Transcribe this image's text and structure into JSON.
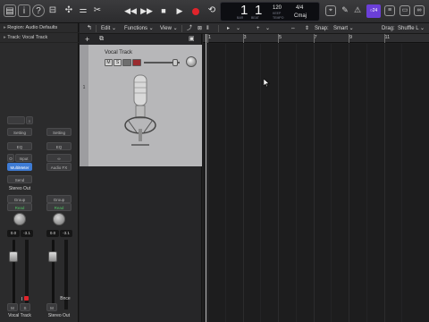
{
  "control_bar": {
    "lcd": {
      "bar": "1",
      "beat": "1",
      "bar_caption": "BAR",
      "beat_caption": "BEAT",
      "tempo": "120",
      "tempo_caption": "KEEP",
      "tempo_caption_2": "TEMPO",
      "signature": "4/4",
      "key": "Cmaj"
    },
    "cpu_label": "○24"
  },
  "inspector": {
    "region_label": "Region: Audio Defaults",
    "track_label": "Track: Vocal Track",
    "channel1": {
      "setting": "Setting",
      "eq": "EQ",
      "input": "Input",
      "input_icon": "O",
      "audio_fx": "MultiMeter",
      "send": "Send",
      "output": "Stereo Out",
      "group": "Group",
      "automation": "Read",
      "pan_value": "0.0",
      "level_value": "-3.1",
      "mute": "M",
      "solo": "S",
      "record": "I",
      "name": "Vocal Track"
    },
    "channel2": {
      "setting": "Setting",
      "eq": "EQ",
      "input_icon": "∞",
      "audio_fx": "Audio FX",
      "group": "Group",
      "automation": "Read",
      "pan_value": "0.0",
      "level_value": "-3.1",
      "bounce": "Bnce",
      "mute": "M",
      "solo": "S",
      "name": "Stereo Out"
    }
  },
  "tracks_header": {
    "edit": "Edit",
    "functions": "Functions",
    "view": "View",
    "snap_label": "Snap:",
    "snap_value": "Smart",
    "drag_label": "Drag:",
    "drag_value": "Shuffle L"
  },
  "track": {
    "number": "1",
    "name": "Vocal Track",
    "mute": "M",
    "solo": "S"
  },
  "ruler": {
    "bars": [
      "1",
      "3",
      "5",
      "7",
      "9",
      "11"
    ]
  },
  "colors": {
    "accent_purple": "#6b3fd8",
    "record_red": "#e0242b",
    "read_green": "#51c163",
    "fx_blue": "#3e7bd4"
  }
}
